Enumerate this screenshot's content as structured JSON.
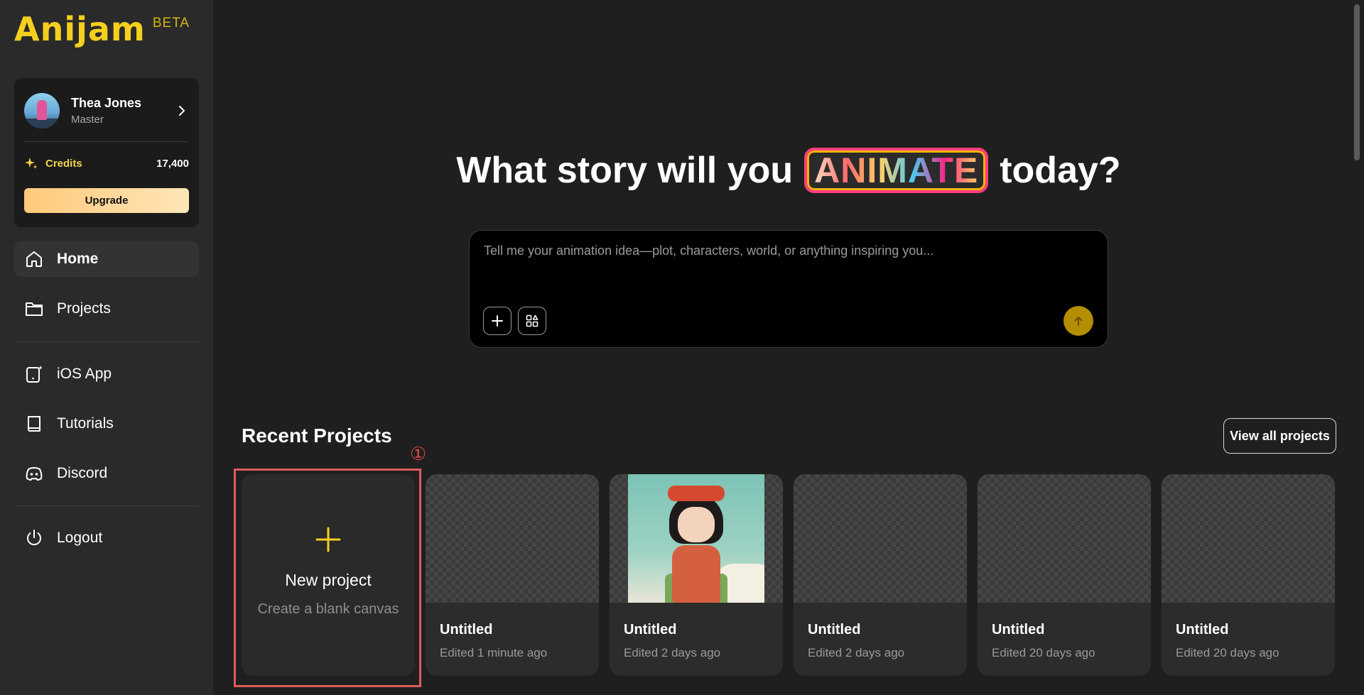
{
  "brand": {
    "name": "Anijam",
    "badge": "BETA",
    "color": "#f5cf1e"
  },
  "user": {
    "name": "Thea Jones",
    "tier": "Master",
    "credits_label": "Credits",
    "credits_value": "17,400",
    "upgrade_label": "Upgrade"
  },
  "nav": {
    "primary": [
      {
        "label": "Home",
        "icon": "home-icon",
        "active": true
      },
      {
        "label": "Projects",
        "icon": "folder-icon",
        "active": false
      }
    ],
    "secondary": [
      {
        "label": "iOS App",
        "icon": "tablet-sparkle-icon"
      },
      {
        "label": "Tutorials",
        "icon": "book-icon"
      },
      {
        "label": "Discord",
        "icon": "discord-icon"
      }
    ],
    "logout": {
      "label": "Logout",
      "icon": "power-icon"
    }
  },
  "hero": {
    "title_before": "What story will you",
    "title_badge": "ANIMATE",
    "title_after": "today?"
  },
  "prompt": {
    "placeholder": "Tell me your animation idea—plot, characters, world, or anything inspiring you..."
  },
  "recent": {
    "title": "Recent Projects",
    "view_all_label": "View all projects",
    "annotation_number": "①",
    "new_project": {
      "title": "New project",
      "subtitle": "Create a blank canvas"
    },
    "projects": [
      {
        "title": "Untitled",
        "edited": "Edited 1 minute ago",
        "thumbnail": "transparent"
      },
      {
        "title": "Untitled",
        "edited": "Edited 2 days ago",
        "thumbnail": "anime-girl-illustration"
      },
      {
        "title": "Untitled",
        "edited": "Edited 2 days ago",
        "thumbnail": "transparent"
      },
      {
        "title": "Untitled",
        "edited": "Edited 20 days ago",
        "thumbnail": "transparent"
      },
      {
        "title": "Untitled",
        "edited": "Edited 20 days ago",
        "thumbnail": "transparent"
      }
    ]
  },
  "colors": {
    "accent": "#f5cf1e",
    "send_button": "#b48d00",
    "annotation": "#e05a5a",
    "badge_border": "#ff3d7f"
  }
}
